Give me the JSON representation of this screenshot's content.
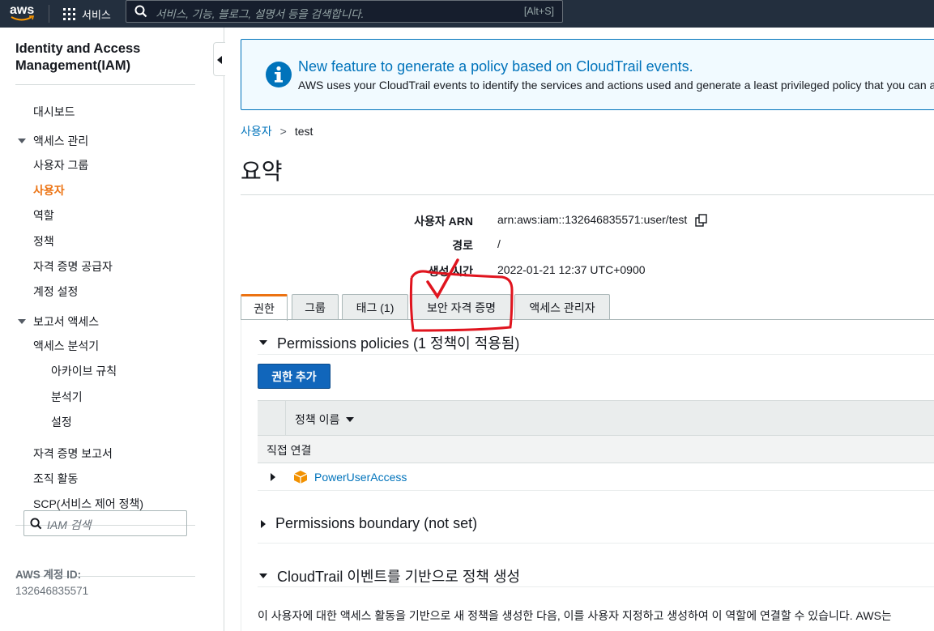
{
  "topnav": {
    "logo_text": "aws",
    "services_label": "서비스",
    "search_placeholder": "서비스, 기능, 블로그, 설명서 등을 검색합니다.",
    "search_shortcut": "[Alt+S]"
  },
  "sidebar": {
    "title": "Identity and Access Management(IAM)",
    "dashboard": "대시보드",
    "access_mgmt": {
      "label": "액세스 관리",
      "items": [
        "사용자 그룹",
        "사용자",
        "역할",
        "정책",
        "자격 증명 공급자",
        "계정 설정"
      ],
      "active": "사용자"
    },
    "report_access": {
      "label": "보고서 액세스",
      "analyzer": "액세스 분석기",
      "sub_items": [
        "아카이브 규칙",
        "분석기",
        "설정"
      ],
      "items": [
        "자격 증명 보고서",
        "조직 활동",
        "SCP(서비스 제어 정책)"
      ]
    },
    "search_placeholder": "IAM 검색",
    "account_label": "AWS 계정 ID:",
    "account_id": "132646835571"
  },
  "flash": {
    "title": "New feature to generate a policy based on CloudTrail events.",
    "description": "AWS uses your CloudTrail events to identify the services and actions used and generate a least privileged policy that you can attach to this user."
  },
  "breadcrumb": {
    "parent": "사용자",
    "separator": ">",
    "current": "test"
  },
  "page_title": "요약",
  "summary": [
    {
      "label": "사용자 ARN",
      "value": "arn:aws:iam::132646835571:user/test"
    },
    {
      "label": "경로",
      "value": "/"
    },
    {
      "label": "생성 시간",
      "value": "2022-01-21 12:37 UTC+0900"
    }
  ],
  "tabs": [
    {
      "label": "권한",
      "active": true
    },
    {
      "label": "그룹",
      "active": false
    },
    {
      "label": "태그 (1)",
      "active": false
    },
    {
      "label": "보안 자격 증명",
      "active": false
    },
    {
      "label": "액세스 관리자",
      "active": false
    }
  ],
  "permissions": {
    "section_title": "Permissions policies (1 정책이 적용됨)",
    "add_button": "권한 추가",
    "table": {
      "column": "정책 이름",
      "group": "직접 연결",
      "rows": [
        "PowerUserAccess"
      ]
    }
  },
  "boundary": {
    "section_title": "Permissions boundary (not set)"
  },
  "cloudtrail": {
    "section_title": "CloudTrail 이벤트를 기반으로 정책 생성",
    "description": "이 사용자에 대한 액세스 활동을 기반으로 새 정책을 생성한 다음, 이를 사용자 지정하고 생성하여 이 역할에 연결할 수 있습니다. AWS는"
  },
  "colors": {
    "nav_bg": "#232f3e",
    "accent_orange": "#ec7211",
    "link_blue": "#0073bb",
    "annotation_red": "#e0141e"
  }
}
